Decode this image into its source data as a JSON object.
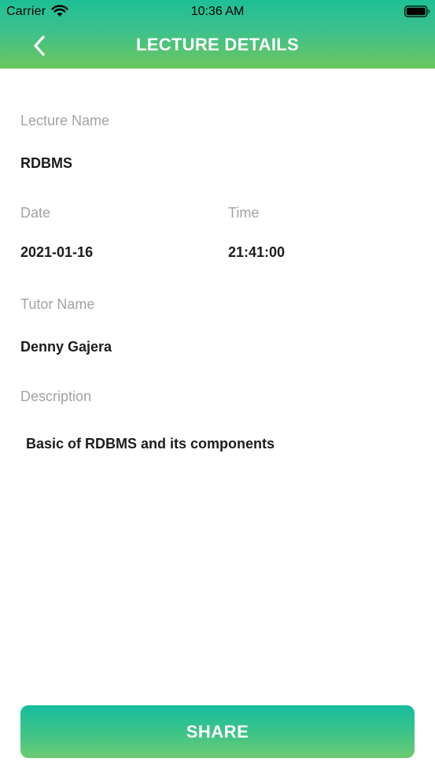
{
  "status_bar": {
    "carrier": "Carrier",
    "time": "10:36 AM",
    "icons": [
      "wifi-icon",
      "battery-icon"
    ]
  },
  "header": {
    "title": "LECTURE DETAILS",
    "back_icon": "chevron-left-icon"
  },
  "details": {
    "lecture_name_label": "Lecture Name",
    "lecture_name_value": "RDBMS",
    "date_label": "Date",
    "date_value": "2021-01-16",
    "time_label": "Time",
    "time_value": "21:41:00",
    "tutor_label": "Tutor Name",
    "tutor_value": "Denny Gajera",
    "description_label": "Description",
    "description_value": "Basic of RDBMS and its components"
  },
  "actions": {
    "share_label": "SHARE"
  },
  "colors": {
    "accent_top": "#1ebf95",
    "accent_bottom": "#6cc65e",
    "label_gray": "#a3a3a3",
    "value_dark": "#1c1c1c"
  }
}
